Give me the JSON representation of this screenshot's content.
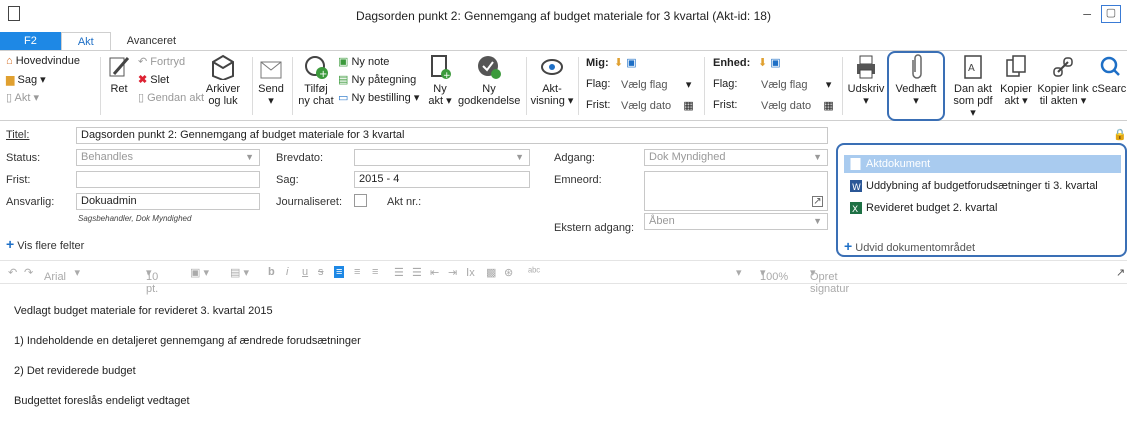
{
  "window": {
    "title": "Dagsorden punkt 2: Gennemgang af budget materiale for 3 kvartal (Akt-id: 18)"
  },
  "tabs": [
    "F2",
    "Akt",
    "Avanceret"
  ],
  "ribbon": {
    "hovedvindue": "Hovedvindue",
    "sag": "Sag",
    "akt": "Akt",
    "ret": "Ret",
    "fortryd": "Fortryd",
    "slet": "Slet",
    "gendan_akt": "Gendan akt",
    "arkiver_1": "Arkiver",
    "arkiver_2": "og luk",
    "send": "Send",
    "tilfoej_1": "Tilføj",
    "tilfoej_2": "ny chat",
    "ny_note": "Ny note",
    "ny_paategning": "Ny påtegning",
    "ny_bestilling": "Ny bestilling",
    "ny_akt_1": "Ny",
    "ny_akt_2": "akt",
    "ny_godk_1": "Ny",
    "ny_godk_2": "godkendelse",
    "aktvisning_1": "Akt-",
    "aktvisning_2": "visning",
    "mig": "Mig:",
    "enhed": "Enhed:",
    "flag_label": "Flag:",
    "frist_label": "Frist:",
    "vaelg_flag": "Vælg flag",
    "vaelg_dato": "Vælg dato",
    "udskriv": "Udskriv",
    "vedhaeft": "Vedhæft",
    "dan_akt_1": "Dan akt",
    "dan_akt_2": "som pdf",
    "kopier_akt_1": "Kopier",
    "kopier_akt_2": "akt",
    "kopier_link_1": "Kopier link",
    "kopier_link_2": "til akten",
    "csearch": "cSearch"
  },
  "form": {
    "titel_label": "Titel:",
    "titel_value": "Dagsorden punkt 2: Gennemgang af budget materiale for 3 kvartal",
    "status_label": "Status:",
    "status_value": "Behandles",
    "frist_label": "Frist:",
    "ansvarlig_label": "Ansvarlig:",
    "ansvarlig_value": "Dokuadmin",
    "sagsbehandler_note": "Sagsbehandler, Dok Myndighed",
    "brevdato_label": "Brevdato:",
    "sag_label": "Sag:",
    "sag_value": "2015 - 4",
    "journaliseret_label": "Journaliseret:",
    "aktnr_label": "Akt nr.:",
    "adgang_label": "Adgang:",
    "adgang_value": "Dok Myndighed",
    "emneord_label": "Emneord:",
    "ekstern_label": "Ekstern adgang:",
    "ekstern_value": "Åben",
    "vis_flere": "Vis flere felter"
  },
  "documents": {
    "items": [
      "Aktdokument",
      "Uddybning af budgetforudsætninger ti 3. kvartal",
      "Revideret budget 2. kvartal"
    ],
    "udvid": "Udvid dokumentområdet"
  },
  "fmtbar": {
    "font": "Arial",
    "size": "10 pt.",
    "zoom": "100%",
    "signatur": "Opret signatur"
  },
  "body": {
    "lines": [
      "Vedlagt budget materiale for revideret 3. kvartal 2015",
      "1) Indeholdende en detaljeret gennemgang af ændrede forudsætninger",
      "2) Det reviderede budget",
      "Budgettet foreslås endeligt vedtaget"
    ]
  },
  "colors": {
    "accent": "#1e88e5",
    "highlight": "#3a6fb5",
    "selected": "#a9cbef"
  }
}
